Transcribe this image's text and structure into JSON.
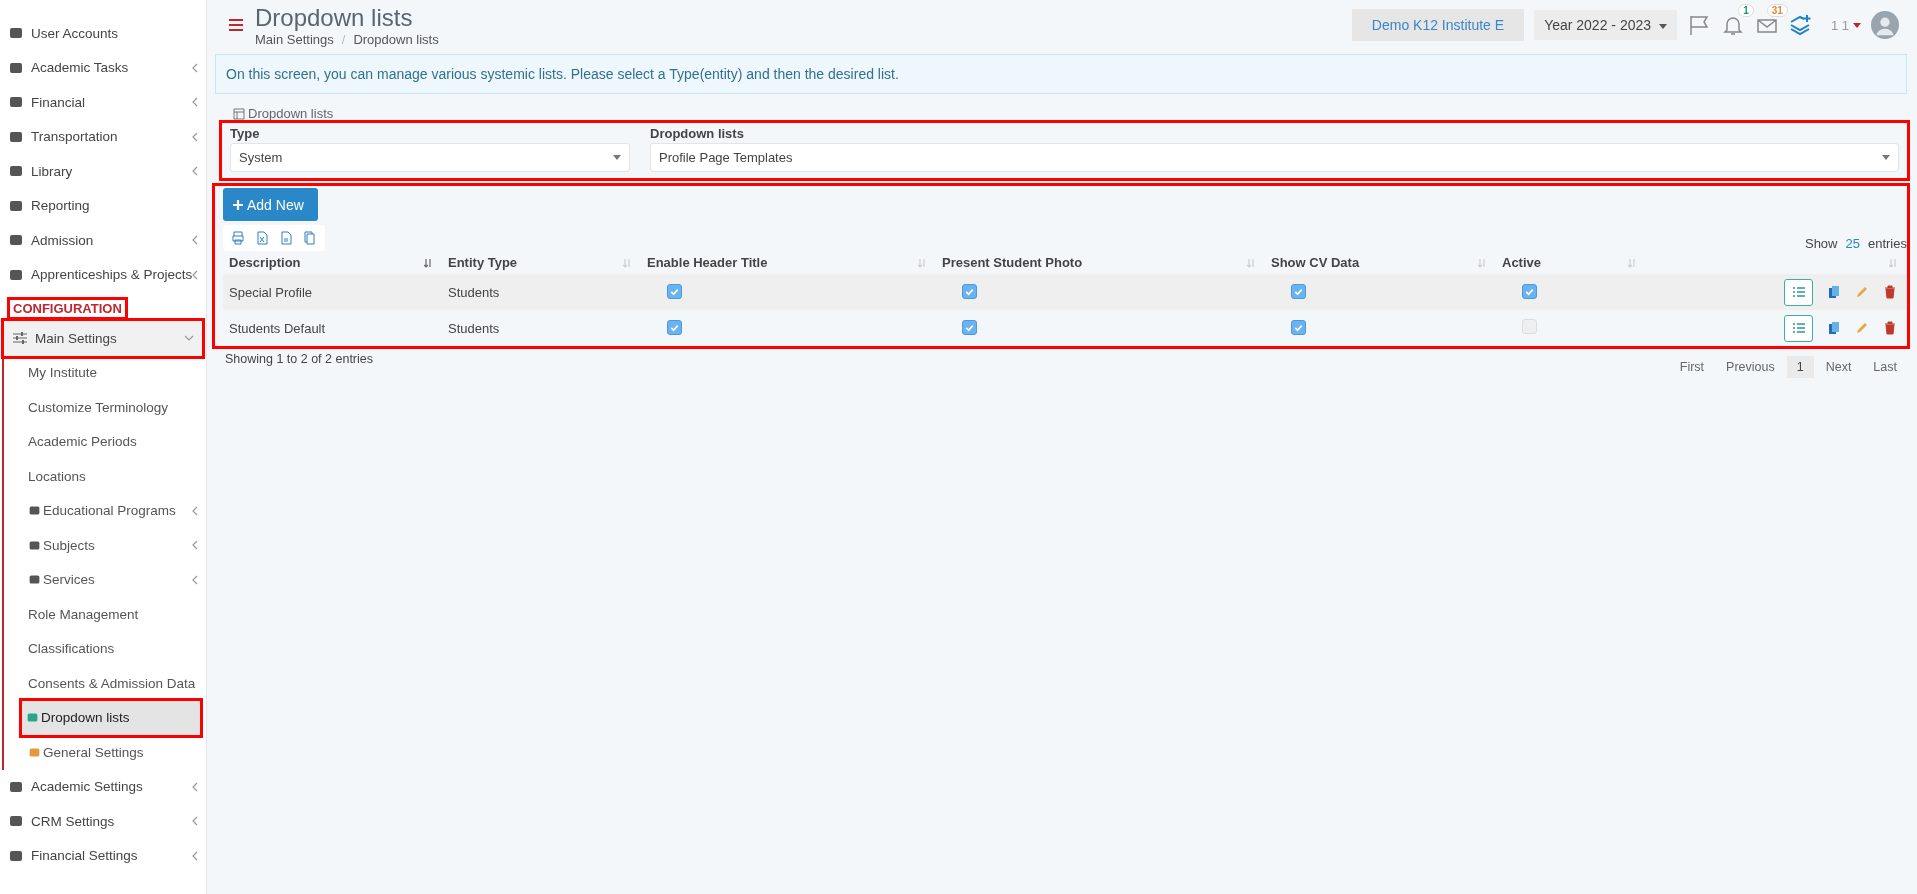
{
  "sidebar": {
    "items": [
      {
        "label": "User Accounts",
        "chevron": false
      },
      {
        "label": "Academic Tasks",
        "chevron": true
      },
      {
        "label": "Financial",
        "chevron": true
      },
      {
        "label": "Transportation",
        "chevron": true
      },
      {
        "label": "Library",
        "chevron": true
      },
      {
        "label": "Reporting",
        "chevron": false
      },
      {
        "label": "Admission",
        "chevron": true
      },
      {
        "label": "Apprenticeships & Projects",
        "chevron": true
      }
    ],
    "section": {
      "label": "CONFIGURATION",
      "highlighted": true
    },
    "group": {
      "label": "Main Settings",
      "expanded": true,
      "highlighted": true,
      "children": [
        {
          "label": "My Institute",
          "chevron": false,
          "selected": false,
          "highlighted": false
        },
        {
          "label": "Customize Terminology",
          "chevron": false,
          "selected": false,
          "highlighted": false
        },
        {
          "label": "Academic Periods",
          "chevron": false,
          "selected": false,
          "highlighted": false
        },
        {
          "label": "Locations",
          "chevron": false,
          "selected": false,
          "highlighted": false
        },
        {
          "label": "Educational Programs",
          "chevron": true,
          "selected": false,
          "highlighted": false
        },
        {
          "label": "Subjects",
          "chevron": true,
          "selected": false,
          "highlighted": false
        },
        {
          "label": "Services",
          "chevron": true,
          "selected": false,
          "highlighted": false
        },
        {
          "label": "Role Management",
          "chevron": false,
          "selected": false,
          "highlighted": false
        },
        {
          "label": "Classifications",
          "chevron": false,
          "selected": false,
          "highlighted": false
        },
        {
          "label": "Consents & Admission Data",
          "chevron": false,
          "selected": false,
          "highlighted": false
        },
        {
          "label": "Dropdown lists",
          "chevron": false,
          "selected": true,
          "highlighted": true
        },
        {
          "label": "General Settings",
          "chevron": false,
          "selected": false,
          "highlighted": false
        }
      ]
    },
    "items_after": [
      {
        "label": "Academic Settings",
        "chevron": true
      },
      {
        "label": "CRM Settings",
        "chevron": true
      },
      {
        "label": "Financial Settings",
        "chevron": true
      }
    ]
  },
  "header": {
    "title": "Dropdown lists",
    "breadcrumb": [
      "Main Settings",
      "Dropdown lists"
    ],
    "breadcrumb_separator": "/",
    "institute": "Demo K12 Institute E",
    "year": "Year 2022 - 2023",
    "notifications": "1",
    "messages": "31",
    "user": "1 1"
  },
  "info": "On this screen, you can manage various systemic lists. Please select a Type(entity) and then the desired list.",
  "filter": {
    "legend": "Dropdown lists",
    "highlighted": true,
    "fields": [
      {
        "label": "Type",
        "value": "System"
      },
      {
        "label": "Dropdown lists",
        "value": "Profile Page Templates"
      }
    ]
  },
  "table": {
    "highlighted": true,
    "add_button": "Add New",
    "show_label": "Show",
    "page_size": "25",
    "entries_label": "entries",
    "columns": [
      {
        "label": "Description",
        "sorted": true
      },
      {
        "label": "Entity Type",
        "sorted": false
      },
      {
        "label": "Enable Header Title",
        "sorted": false
      },
      {
        "label": "Present Student Photo",
        "sorted": false
      },
      {
        "label": "Show CV Data",
        "sorted": false
      },
      {
        "label": "Active",
        "sorted": false
      },
      {
        "sorted": false
      }
    ],
    "rows": [
      {
        "description": "Special Profile",
        "entity_type": "Students",
        "enable_header_title": true,
        "present_student_photo": true,
        "show_cv_data": true,
        "active": true
      },
      {
        "description": "Students Default",
        "entity_type": "Students",
        "enable_header_title": true,
        "present_student_photo": true,
        "show_cv_data": true,
        "active": false
      }
    ],
    "summary": "Showing 1 to 2 of 2 entries",
    "pagination": [
      {
        "label": "First",
        "selected": false
      },
      {
        "label": "Previous",
        "selected": false
      },
      {
        "label": "1",
        "selected": true
      },
      {
        "label": "Next",
        "selected": false
      },
      {
        "label": "Last",
        "selected": false
      }
    ]
  }
}
